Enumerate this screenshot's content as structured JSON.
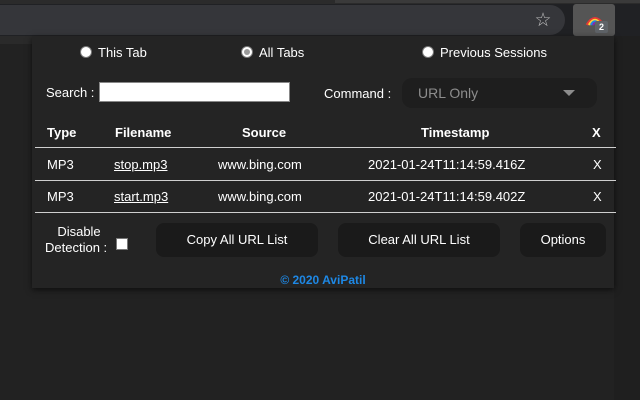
{
  "browser": {
    "bookmark_icon": "star-outline-icon",
    "extension_icon": "rainbow-logo-icon",
    "extension_badge": "2"
  },
  "scope": {
    "options": [
      "This Tab",
      "All Tabs",
      "Previous Sessions"
    ],
    "selected": "All Tabs"
  },
  "search": {
    "label": "Search :",
    "value": ""
  },
  "command": {
    "label": "Command :",
    "selected": "URL Only"
  },
  "table": {
    "headers": [
      "Type",
      "Filename",
      "Source",
      "Timestamp",
      "X"
    ],
    "rows": [
      {
        "type": "MP3",
        "filename": "stop.mp3",
        "source": "www.bing.com",
        "timestamp": "2021-01-24T11:14:59.416Z",
        "remove": "X"
      },
      {
        "type": "MP3",
        "filename": "start.mp3",
        "source": "www.bing.com",
        "timestamp": "2021-01-24T11:14:59.402Z",
        "remove": "X"
      }
    ]
  },
  "detection": {
    "label_line1": "Disable",
    "label_line2": "Detection :",
    "checked": false
  },
  "buttons": {
    "copy": "Copy All URL List",
    "clear": "Clear All URL List",
    "options": "Options"
  },
  "footer": "© 2020 AviPatil",
  "colors": {
    "accent": "#1e88e5",
    "panel": "#242424",
    "button": "#1a1a1a"
  }
}
